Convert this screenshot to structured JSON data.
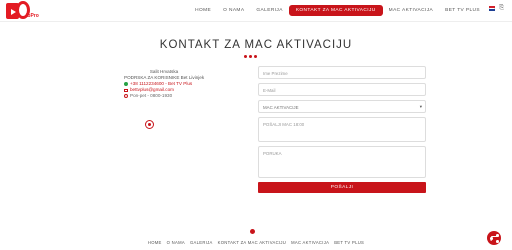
{
  "header": {
    "logo_text": "IbPro",
    "nav": [
      "HOME",
      "O NAMA",
      "GALERIJA",
      "KONTAKT ZA MAC AKTIVACIJU",
      "MAC AKTIVACIJA",
      "BET TV PLUS"
    ],
    "active_index": 3,
    "flag_colors": [
      "#d3202a",
      "#ffffff",
      "#1d3f93"
    ]
  },
  "title": "KONTAKT ZA MAC AKTIVACIJU",
  "contact": {
    "line1": "Salit Hrvatska",
    "line2": "PODRSKA ZA KORISNIKE Bet Livinjek",
    "phone": "+38 1112234600 - Bet TV Plus",
    "email": "bettvplus@gmail.com",
    "hours": "Pon-pet - 0800-1930"
  },
  "form": {
    "name_placeholder": "Ime Prezime",
    "email_placeholder": "E-Mail",
    "select_value": "MAC AKTIVACIJE",
    "mac_placeholder": "POŠALJI MAC 18:00",
    "message_placeholder": "PORUKA",
    "submit_label": "POŠALJI"
  },
  "footer": {
    "nav": [
      "HOME",
      "O NAMA",
      "GALERIJA",
      "KONTAKT ZA MAC AKTIVACIJU",
      "MAC AKTIVACIJA",
      "BET TV PLUS"
    ]
  },
  "colors": {
    "accent": "#c8141a"
  }
}
